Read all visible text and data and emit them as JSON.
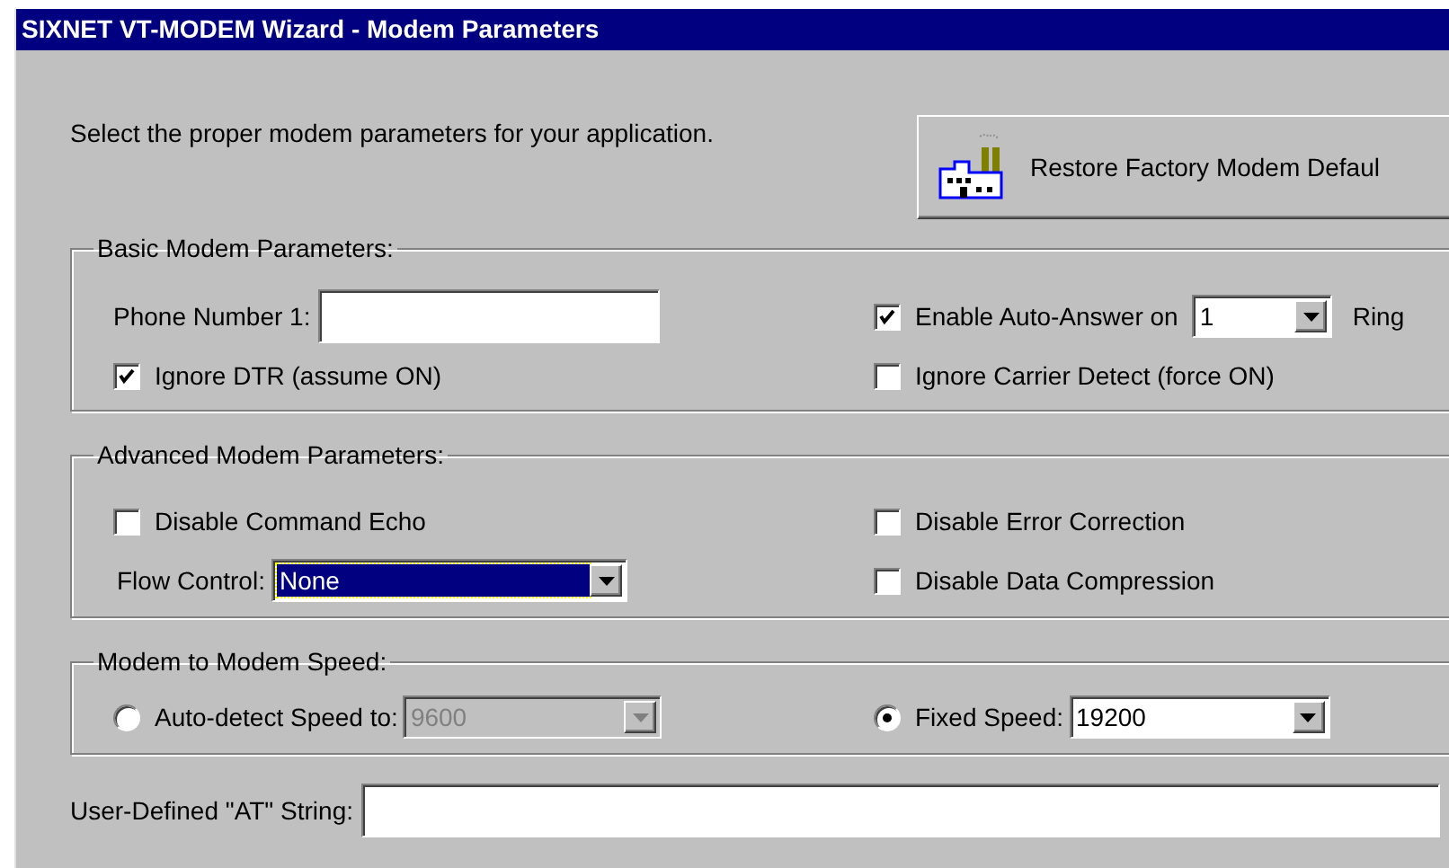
{
  "window": {
    "title": "SIXNET VT-MODEM Wizard - Modem Parameters"
  },
  "intro": "Select the proper modem parameters for your application.",
  "restore_button": {
    "label": "Restore Factory Modem Defaul"
  },
  "basic": {
    "title": "Basic Modem Parameters:",
    "phone_label": "Phone Number 1:",
    "ignore_dtr": {
      "label": "Ignore DTR (assume ON)",
      "checked": true
    },
    "auto_answer": {
      "label": "Enable Auto-Answer on",
      "checked": true,
      "value": "1",
      "suffix": "Ring"
    },
    "ignore_cd": {
      "label": "Ignore Carrier Detect (force ON)",
      "checked": false
    }
  },
  "advanced": {
    "title": "Advanced Modem Parameters:",
    "command_echo": {
      "label": "Disable Command Echo",
      "checked": false
    },
    "error_correction": {
      "label": "Disable Error Correction",
      "checked": false
    },
    "data_compression": {
      "label": "Disable Data Compression",
      "checked": false
    },
    "flow_control": {
      "label": "Flow Control:",
      "value": "None",
      "focused": true
    }
  },
  "speed": {
    "title": "Modem to Modem Speed:",
    "options": [
      {
        "label": "Auto-detect Speed to:",
        "selected": false,
        "value": "9600",
        "disabled": true
      },
      {
        "label": "Fixed Speed:",
        "selected": true,
        "value": "19200",
        "disabled": false
      }
    ]
  },
  "at_string": {
    "label": "User-Defined \"AT\" String:"
  }
}
